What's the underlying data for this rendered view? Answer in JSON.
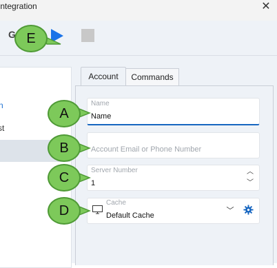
{
  "window": {
    "title": "Integration",
    "close_icon": "close-icon"
  },
  "toolbar": {
    "letter": "G",
    "play_icon": "play-icon",
    "stop_icon": "stop-icon"
  },
  "left_panel": {
    "item_1": "n",
    "item_2": "st"
  },
  "tabs": [
    {
      "label": "Account",
      "selected": true
    },
    {
      "label": "Commands",
      "selected": false
    }
  ],
  "form": {
    "name": {
      "label": "Name",
      "value": "Name"
    },
    "account": {
      "placeholder": "Account Email or Phone Number"
    },
    "server": {
      "label": "Server Number",
      "value": "1"
    },
    "cache": {
      "label": "Cache",
      "value": "Default Cache"
    }
  },
  "callouts": [
    "A",
    "B",
    "C",
    "D",
    "E"
  ],
  "colors": {
    "accent": "#1565c0",
    "callout_fill": "#7dc95a",
    "callout_border": "#4f9a36",
    "panel_bg": "#eef2f7"
  }
}
